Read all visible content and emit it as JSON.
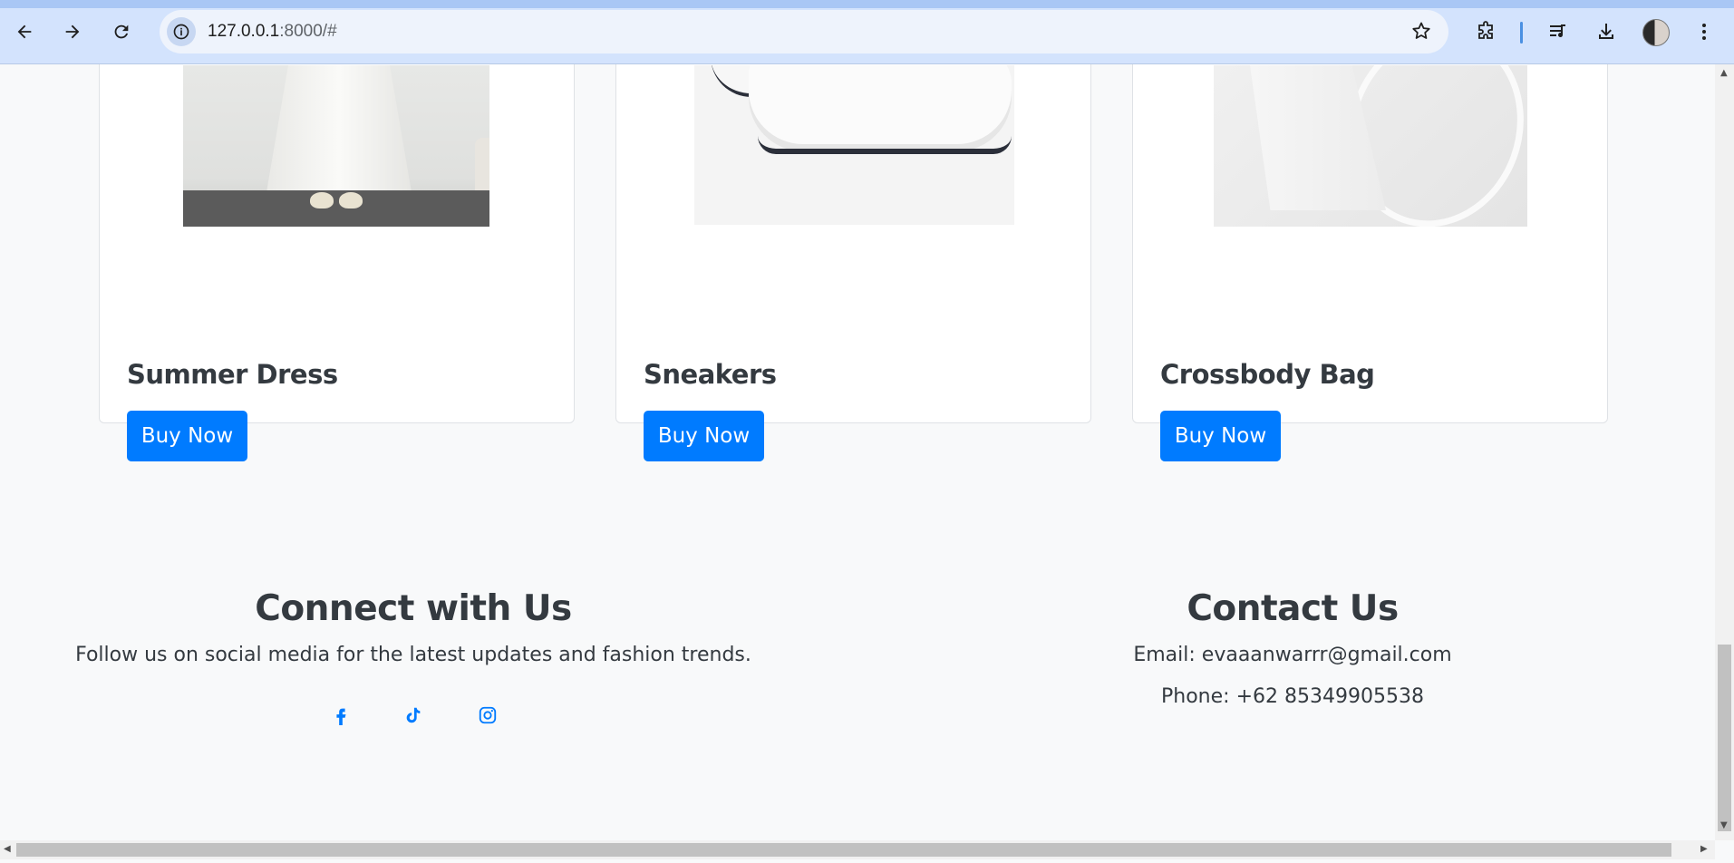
{
  "browser": {
    "url_host": "127.0.0.1",
    "url_path": ":8000/#"
  },
  "products": [
    {
      "name": "Summer Dress",
      "button": "Buy Now"
    },
    {
      "name": "Sneakers",
      "button": "Buy Now"
    },
    {
      "name": "Crossbody Bag",
      "button": "Buy Now"
    }
  ],
  "footer": {
    "connect": {
      "heading": "Connect with Us",
      "text": "Follow us on social media for the latest updates and fashion trends.",
      "icons": [
        "facebook-icon",
        "tiktok-icon",
        "instagram-icon"
      ]
    },
    "contact": {
      "heading": "Contact Us",
      "email": "Email: evaaanwarrr@gmail.com",
      "phone": "Phone: +62 85349905538"
    }
  },
  "colors": {
    "accent": "#007bff",
    "background": "#f8f9fa",
    "text": "#343a40"
  }
}
